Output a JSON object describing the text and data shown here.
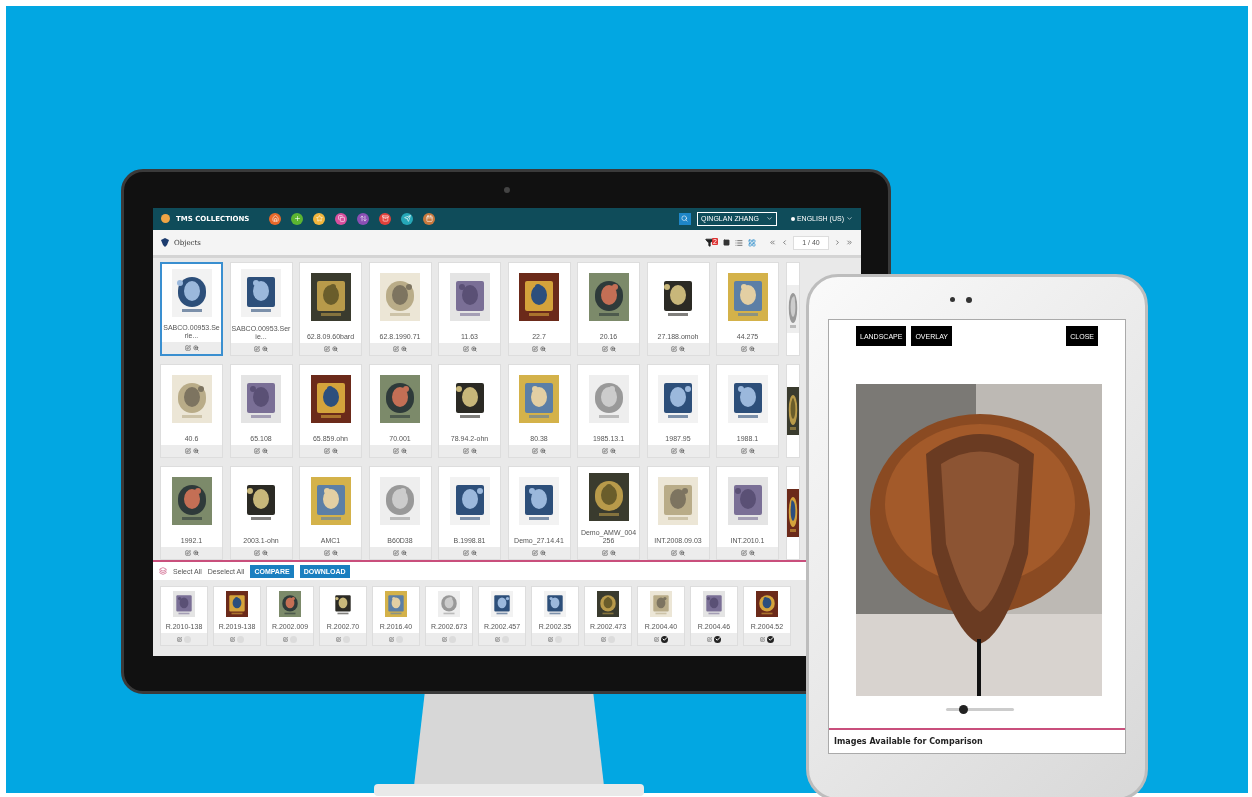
{
  "monitor": {
    "app_bar": {
      "title": "TMS COLLECTIONS",
      "nav_buttons": [
        {
          "color": "#e8692a"
        },
        {
          "color": "#5cb531"
        },
        {
          "color": "#f2b63c"
        },
        {
          "color": "#d84f9e"
        },
        {
          "color": "#8a4fb5"
        },
        {
          "color": "#e0413b"
        },
        {
          "color": "#26a8b8"
        },
        {
          "color": "#c9793e"
        }
      ],
      "user_menu": "QINGLAN ZHANG",
      "language": "ENGLISH (US)"
    },
    "header": {
      "title": "Objects",
      "filter_count": "2",
      "page": "1 / 40"
    },
    "object_rows": [
      {
        "cards": [
          {
            "label": "SABCO.00953.Serie...",
            "selected": true
          },
          {
            "label": "SABCO.00953.Serie...",
            "selected": false
          },
          {
            "label": "62.8.09.60bard",
            "selected": false
          },
          {
            "label": "62.8.1990.71",
            "selected": false
          },
          {
            "label": "11.63",
            "selected": false
          },
          {
            "label": "22.7",
            "selected": false
          },
          {
            "label": "20.16",
            "selected": false
          },
          {
            "label": "27.188.omoh",
            "selected": false
          },
          {
            "label": "44.275",
            "selected": false
          },
          {
            "selected": false
          }
        ]
      },
      {
        "cards": [
          {
            "label": "40.6",
            "selected": false
          },
          {
            "label": "65.108",
            "selected": false
          },
          {
            "label": "65.859.ohn",
            "selected": false
          },
          {
            "label": "70.001",
            "selected": false
          },
          {
            "label": "78.94.2-ohn",
            "selected": false
          },
          {
            "label": "80.38",
            "selected": false
          },
          {
            "label": "1985.13.1",
            "selected": false
          },
          {
            "label": "1987.95",
            "selected": false
          },
          {
            "label": "1988.1",
            "selected": false
          },
          {
            "selected": false
          }
        ]
      },
      {
        "cards": [
          {
            "label": "1992.1",
            "selected": false
          },
          {
            "label": "2003.1-ohn",
            "selected": false
          },
          {
            "label": "AMC1",
            "selected": false
          },
          {
            "label": "B60D38",
            "selected": false
          },
          {
            "label": "B.1998.81",
            "selected": false
          },
          {
            "label": "Demo_27.14.41",
            "selected": false
          },
          {
            "label": "Demo_AMW_004256",
            "selected": false
          },
          {
            "label": "INT.2008.09.03",
            "selected": false
          },
          {
            "label": "INT.2010.1",
            "selected": false
          },
          {
            "selected": false
          }
        ]
      }
    ],
    "selection_bar": {
      "select_all": "Select All",
      "deselect_all": "Deselect All",
      "buttons": [
        "COMPARE",
        "DOWNLOAD"
      ]
    },
    "selected_objects": [
      {
        "label": "R.2010-138",
        "checked": false
      },
      {
        "label": "R.2019-138",
        "checked": false
      },
      {
        "label": "R.2002.009",
        "checked": false
      },
      {
        "label": "R.2002.70",
        "checked": false
      },
      {
        "label": "R.2016.40",
        "checked": false
      },
      {
        "label": "R.2002.673",
        "checked": false
      },
      {
        "label": "R.2002.457",
        "checked": false
      },
      {
        "label": "R.2002.35",
        "checked": false
      },
      {
        "label": "R.2002.473",
        "checked": false
      },
      {
        "label": "R.2004.40",
        "checked": true
      },
      {
        "label": "R.2004.46",
        "checked": true
      },
      {
        "label": "R.2004.52",
        "checked": true
      }
    ]
  },
  "tablet": {
    "buttons": [
      "LANDSCAPE",
      "OVERLAY"
    ],
    "close": "CLOSE",
    "zoom": {
      "level": 0.25
    },
    "caption": "Images Available for Comparison"
  }
}
